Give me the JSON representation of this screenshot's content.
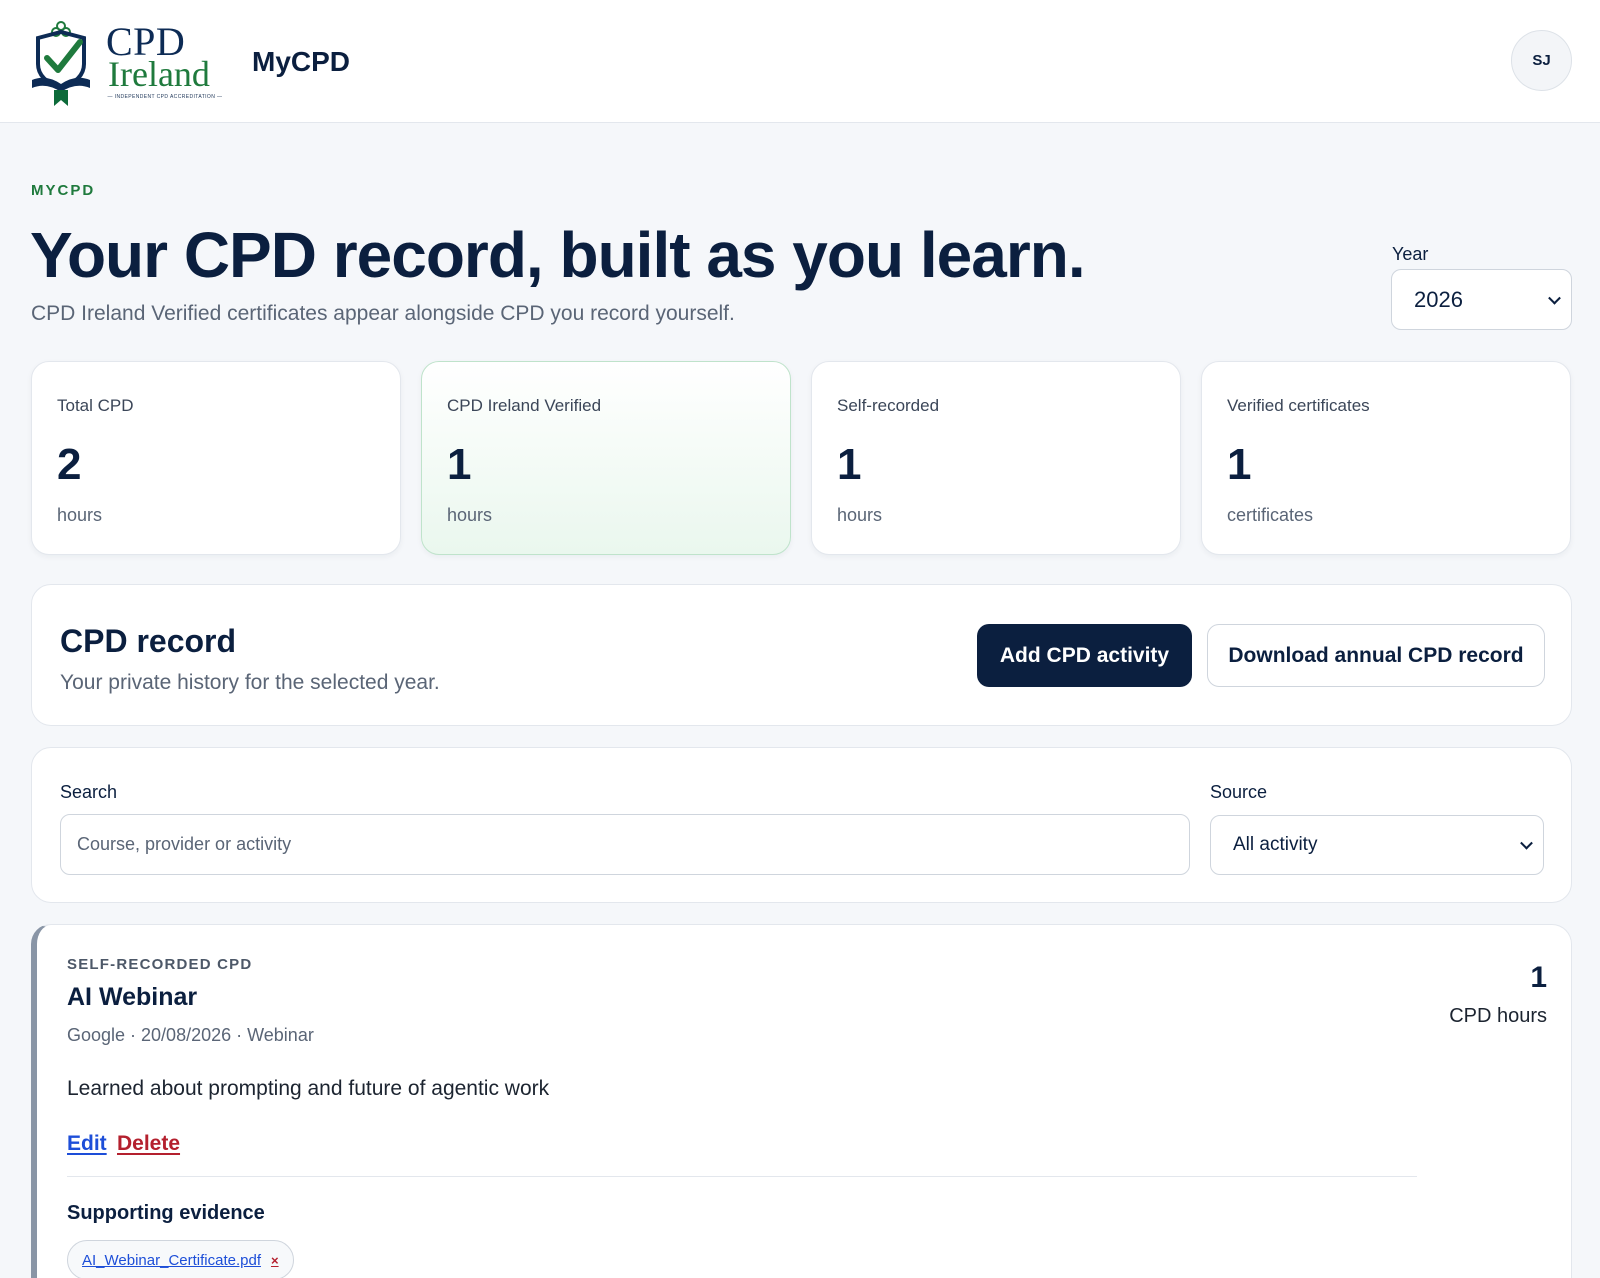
{
  "header": {
    "logo_line1": "CPD",
    "logo_line2": "Ireland",
    "logo_tagline": "— INDEPENDENT CPD ACCREDITATION —",
    "app_name": "MyCPD",
    "avatar_initials": "SJ"
  },
  "hero": {
    "eyebrow": "MYCPD",
    "title": "Your CPD record, built as you learn.",
    "subtitle": "CPD Ireland Verified certificates appear alongside CPD you record yourself.",
    "year_label": "Year",
    "year_value": "2026"
  },
  "stats": [
    {
      "label": "Total CPD",
      "value": "2",
      "unit": "hours"
    },
    {
      "label": "CPD Ireland Verified",
      "value": "1",
      "unit": "hours"
    },
    {
      "label": "Self-recorded",
      "value": "1",
      "unit": "hours"
    },
    {
      "label": "Verified certificates",
      "value": "1",
      "unit": "certificates"
    }
  ],
  "record": {
    "title": "CPD record",
    "subtitle": "Your private history for the selected year.",
    "add_button": "Add CPD activity",
    "download_button": "Download annual CPD record"
  },
  "filters": {
    "search_label": "Search",
    "search_placeholder": "Course, provider or activity",
    "source_label": "Source",
    "source_value": "All activity"
  },
  "activities": [
    {
      "kicker": "SELF-RECORDED CPD",
      "title": "AI Webinar",
      "meta": "Google · 20/08/2026 · Webinar",
      "description": "Learned about prompting and future of agentic work",
      "hours": "1",
      "hours_label": "CPD hours",
      "edit_label": "Edit",
      "delete_label": "Delete",
      "evidence_title": "Supporting evidence",
      "evidence_file": "AI_Webinar_Certificate.pdf",
      "evidence_remove": "×"
    }
  ],
  "colors": {
    "navy": "#0b1f3f",
    "brand_green": "#1f7a3d",
    "link_blue": "#1d4ed8",
    "danger_red": "#b4202e"
  },
  "icons": {
    "logo": "cpd-ireland-crest-icon",
    "year_dropdown": "chevron-down-icon",
    "source_dropdown": "chevron-down-icon"
  }
}
